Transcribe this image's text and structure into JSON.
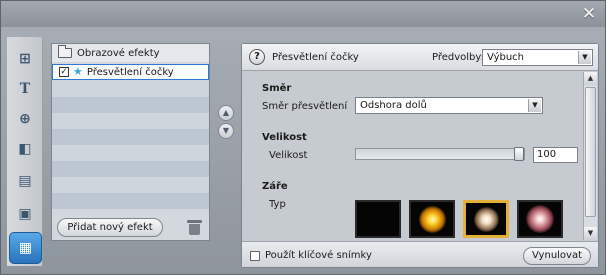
{
  "window": {
    "close_glyph": "✕"
  },
  "toolbar": {
    "items": [
      {
        "name": "video-effects-tool-icon",
        "glyph": "⊞"
      },
      {
        "name": "title-tool-icon",
        "glyph": "T"
      },
      {
        "name": "audio-tool-icon",
        "glyph": "⊕"
      },
      {
        "name": "camera-tool-icon",
        "glyph": "◧"
      },
      {
        "name": "clapper-tool-icon",
        "glyph": "▤"
      },
      {
        "name": "frame-tool-icon",
        "glyph": "▣"
      },
      {
        "name": "effects-tool-icon",
        "glyph": "▦"
      }
    ]
  },
  "effects_list": {
    "category_label": "Obrazové efekty",
    "selected_effect_label": "Přesvětlení čočky",
    "selected_effect_checked": "✓",
    "add_button_label": "Přidat nový efekt"
  },
  "order_arrows": {
    "up": "▲",
    "down": "▼"
  },
  "editor": {
    "help_glyph": "?",
    "title": "Přesvětlení čočky",
    "presets_label": "Předvolby:",
    "presets_value": "Výbuch",
    "sections": {
      "direction_title": "Směr",
      "direction_label": "Směr přesvětlení",
      "direction_value": "Odshora dolů",
      "size_title": "Velikost",
      "size_label": "Velikost",
      "size_value": "100",
      "size_fraction": 1.0,
      "glow_title": "Záře",
      "type_label": "Typ"
    },
    "glow_types": [
      {
        "id": "none",
        "selected": false
      },
      {
        "id": "gold",
        "selected": false
      },
      {
        "id": "white",
        "selected": true
      },
      {
        "id": "pink",
        "selected": false
      }
    ],
    "keyframes_label": "Použít klíčové snímky",
    "reset_label": "Vynulovat"
  },
  "dropdown_glyph": "▼",
  "scroll_up_glyph": "▲",
  "scroll_down_glyph": "▼"
}
